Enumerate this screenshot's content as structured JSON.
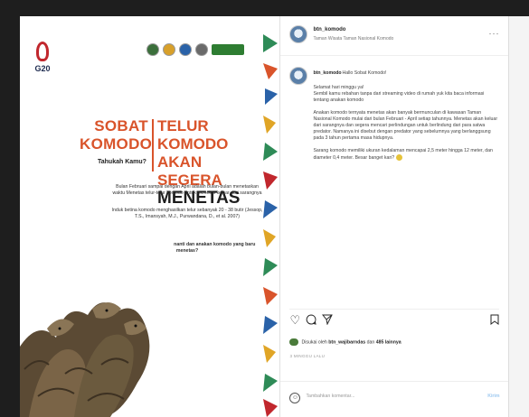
{
  "post": {
    "account": "btn_komodo",
    "location": "Taman Wisata Taman Nasional Komodo",
    "image": {
      "brand": "G20",
      "headline_left": [
        "SOBAT",
        "KOMODO"
      ],
      "headline_right": [
        "TELUR KOMODO",
        "AKAN SEGERA"
      ],
      "headline_emphasis": "MENETAS",
      "question_small": "Tahukah Kamu?",
      "paragraph_1": "Bulan Februari sampai dengan April adalah bulan-bulan menetaskan waktu Menetas telur-telur komodo untuk menetas keluar dari sarangnya",
      "paragraph_2": "Induk betina komodo menghasilkan telur sebanyak 20 - 38 butir (Jessop, T.S., Imansyah, M.J., Purwandana, D., et al. 2007)",
      "paragraph_3": "Bagaimana ya, Hasilnya nanti dan anakan komodo yang baru menetas?"
    },
    "caption": {
      "user": "btn_komodo",
      "greeting": "Hallo Sobat Komodo!",
      "text": "Selamat hari minggu ya!\nSembil kamu rebahan tanpa dari streaming video di rumah yuk kita baca informasi tentang anakan komodo\n\nAnakan komodo ternyata menetas akan banyak bermunculan di kawasan Taman Nasional Komodo mulai dari bulan Februari - April setiap tahunnya. Menetas akan keluar dari sarangnya dan segera mencari perlindungan untuk berlindung dari para satwa predator. Namanya ini disebut dengan predator yang sebelumnya yang berlanggsung pada 3 tahun pertama masa hidupnya.\n\nSarang komodo memiliki ukuran kedalaman mencapai 2,5 meter hingga 12 meter, dan diameter 0,4 meter. Besar banget kan?"
    },
    "actions": {
      "like_icon": "heart-icon",
      "comment_icon": "comment-icon",
      "share_icon": "send-icon",
      "save_icon": "bookmark-icon"
    },
    "likes": {
      "prefix": "Disukai oleh",
      "first_user": "btn_wajibarndas",
      "middle": "dan",
      "others": "485 lainnya"
    },
    "date": "3 MINGGU LALU",
    "comment_placeholder": "Tambahkan komentar...",
    "post_button": "Kirim"
  },
  "colors": {
    "accent_orange": "#d9542b",
    "link_blue": "#9ec9f0"
  }
}
